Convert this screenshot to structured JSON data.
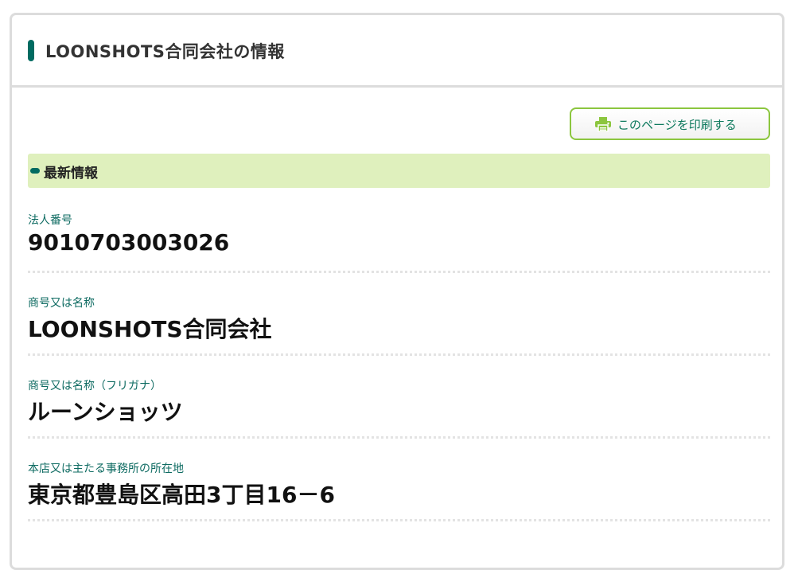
{
  "header": {
    "title": "LOONSHOTS合同会社の情報"
  },
  "toolbar": {
    "print_label": "このページを印刷する",
    "print_icon": "printer-icon",
    "accent_color": "#8cc63f"
  },
  "section": {
    "title": "最新情報",
    "band_color": "#dff0bd",
    "marker_color": "#006b61"
  },
  "fields": [
    {
      "label": "法人番号",
      "value": "9010703003026"
    },
    {
      "label": "商号又は名称",
      "value": "LOONSHOTS合同会社"
    },
    {
      "label": "商号又は名称（フリガナ）",
      "value": "ルーンショッツ"
    },
    {
      "label": "本店又は主たる事務所の所在地",
      "value": "東京都豊島区高田3丁目16－6"
    }
  ]
}
